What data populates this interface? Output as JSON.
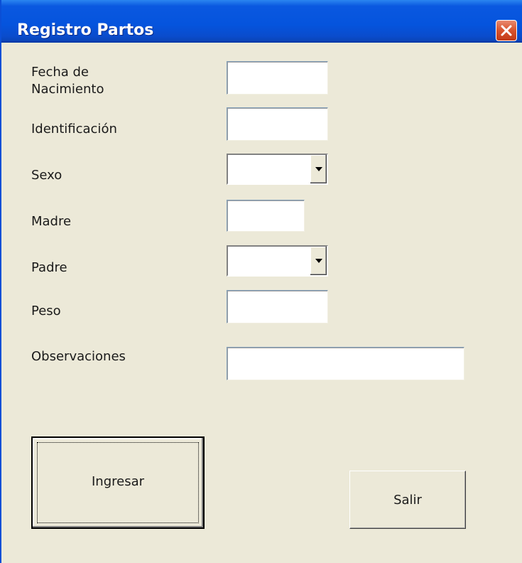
{
  "window": {
    "title": "Registro Partos"
  },
  "form": {
    "fecha_label_line1": "Fecha de",
    "fecha_label_line2": "Nacimiento",
    "fecha_value": "",
    "identificacion_label": "Identificación",
    "identificacion_value": "",
    "sexo_label": "Sexo",
    "sexo_value": "",
    "madre_label": "Madre",
    "madre_value": "",
    "padre_label": "Padre",
    "padre_value": "",
    "peso_label": "Peso",
    "peso_value": "",
    "observaciones_label": "Observaciones",
    "observaciones_value": ""
  },
  "buttons": {
    "ingresar_label": "Ingresar",
    "salir_label": "Salir"
  },
  "icons": {
    "close": "close-icon",
    "dropdown": "dropdown-arrow-icon"
  },
  "colors": {
    "titlebar": "#0554dd",
    "background": "#ece9d8",
    "close_button": "#d8522c"
  }
}
